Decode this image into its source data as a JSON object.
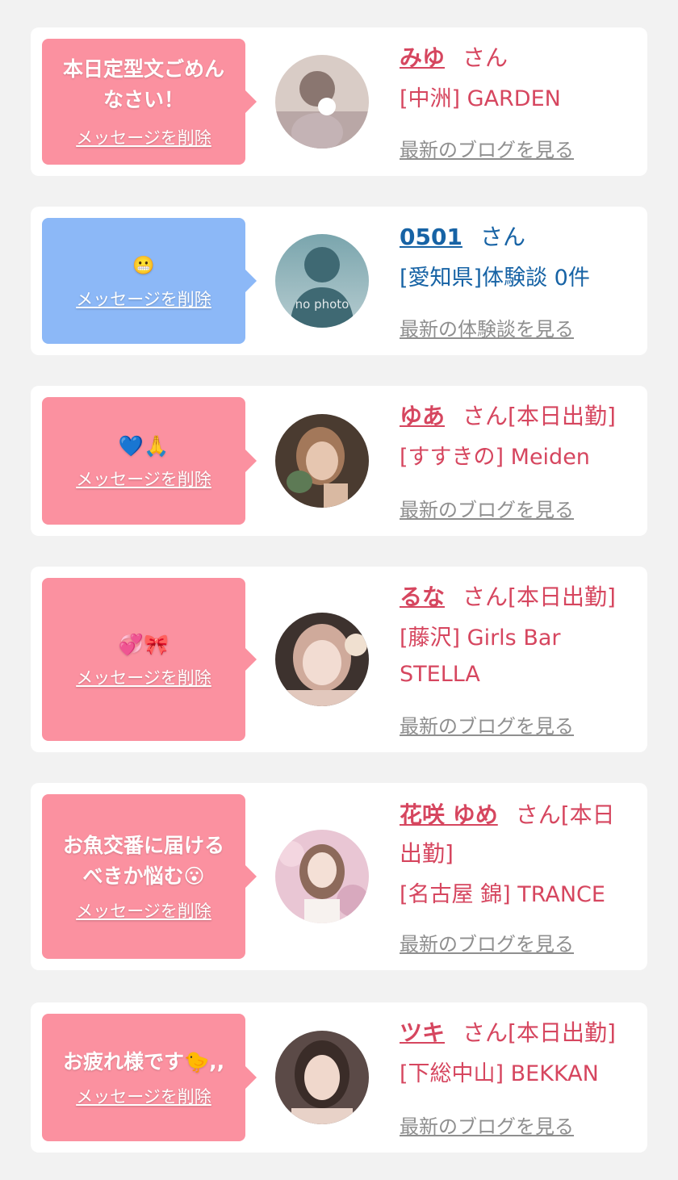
{
  "delete_label": "メッセージを削除",
  "blog_link": "最新のブログを見る",
  "review_link": "最新の体験談を見る",
  "no_photo": "no photo",
  "colors": {
    "pink_bubble": "#fb91a0",
    "blue_bubble": "#8cb8f7",
    "name_pink": "#d6465f",
    "name_blue": "#1763a5",
    "link_gray": "#8f8f8f"
  },
  "messages": [
    {
      "message": "本日定型文ごめん\nなさい！",
      "name": "みゆ",
      "suffix": "さん",
      "shop": "[中洲] GARDEN",
      "link": "最新のブログを見る"
    },
    {
      "message": "😬",
      "name": "0501",
      "suffix": "さん",
      "shop": "[愛知県]体験談 0件",
      "link": "最新の体験談を見る"
    },
    {
      "message": "💙🙏",
      "name": "ゆあ",
      "suffix": "さん[本日出勤]",
      "shop": "[すすきの] Meiden",
      "link": "最新のブログを見る"
    },
    {
      "message": "💞🎀",
      "name": "るな",
      "suffix": "さん[本日出勤]",
      "shop": "[藤沢] Girls Bar STELLA",
      "link": "最新のブログを見る"
    },
    {
      "message": "お魚交番に届ける\nべきか悩む😮",
      "name": "花咲 ゆめ",
      "suffix": "さん[本日出勤]",
      "shop": "[名古屋 錦] TRANCE",
      "link": "最新のブログを見る"
    },
    {
      "message": "お疲れ様です🐤,,",
      "name": "ツキ",
      "suffix": "さん[本日出勤]",
      "shop": "[下総中山] BEKKAN",
      "link": "最新のブログを見る"
    }
  ]
}
